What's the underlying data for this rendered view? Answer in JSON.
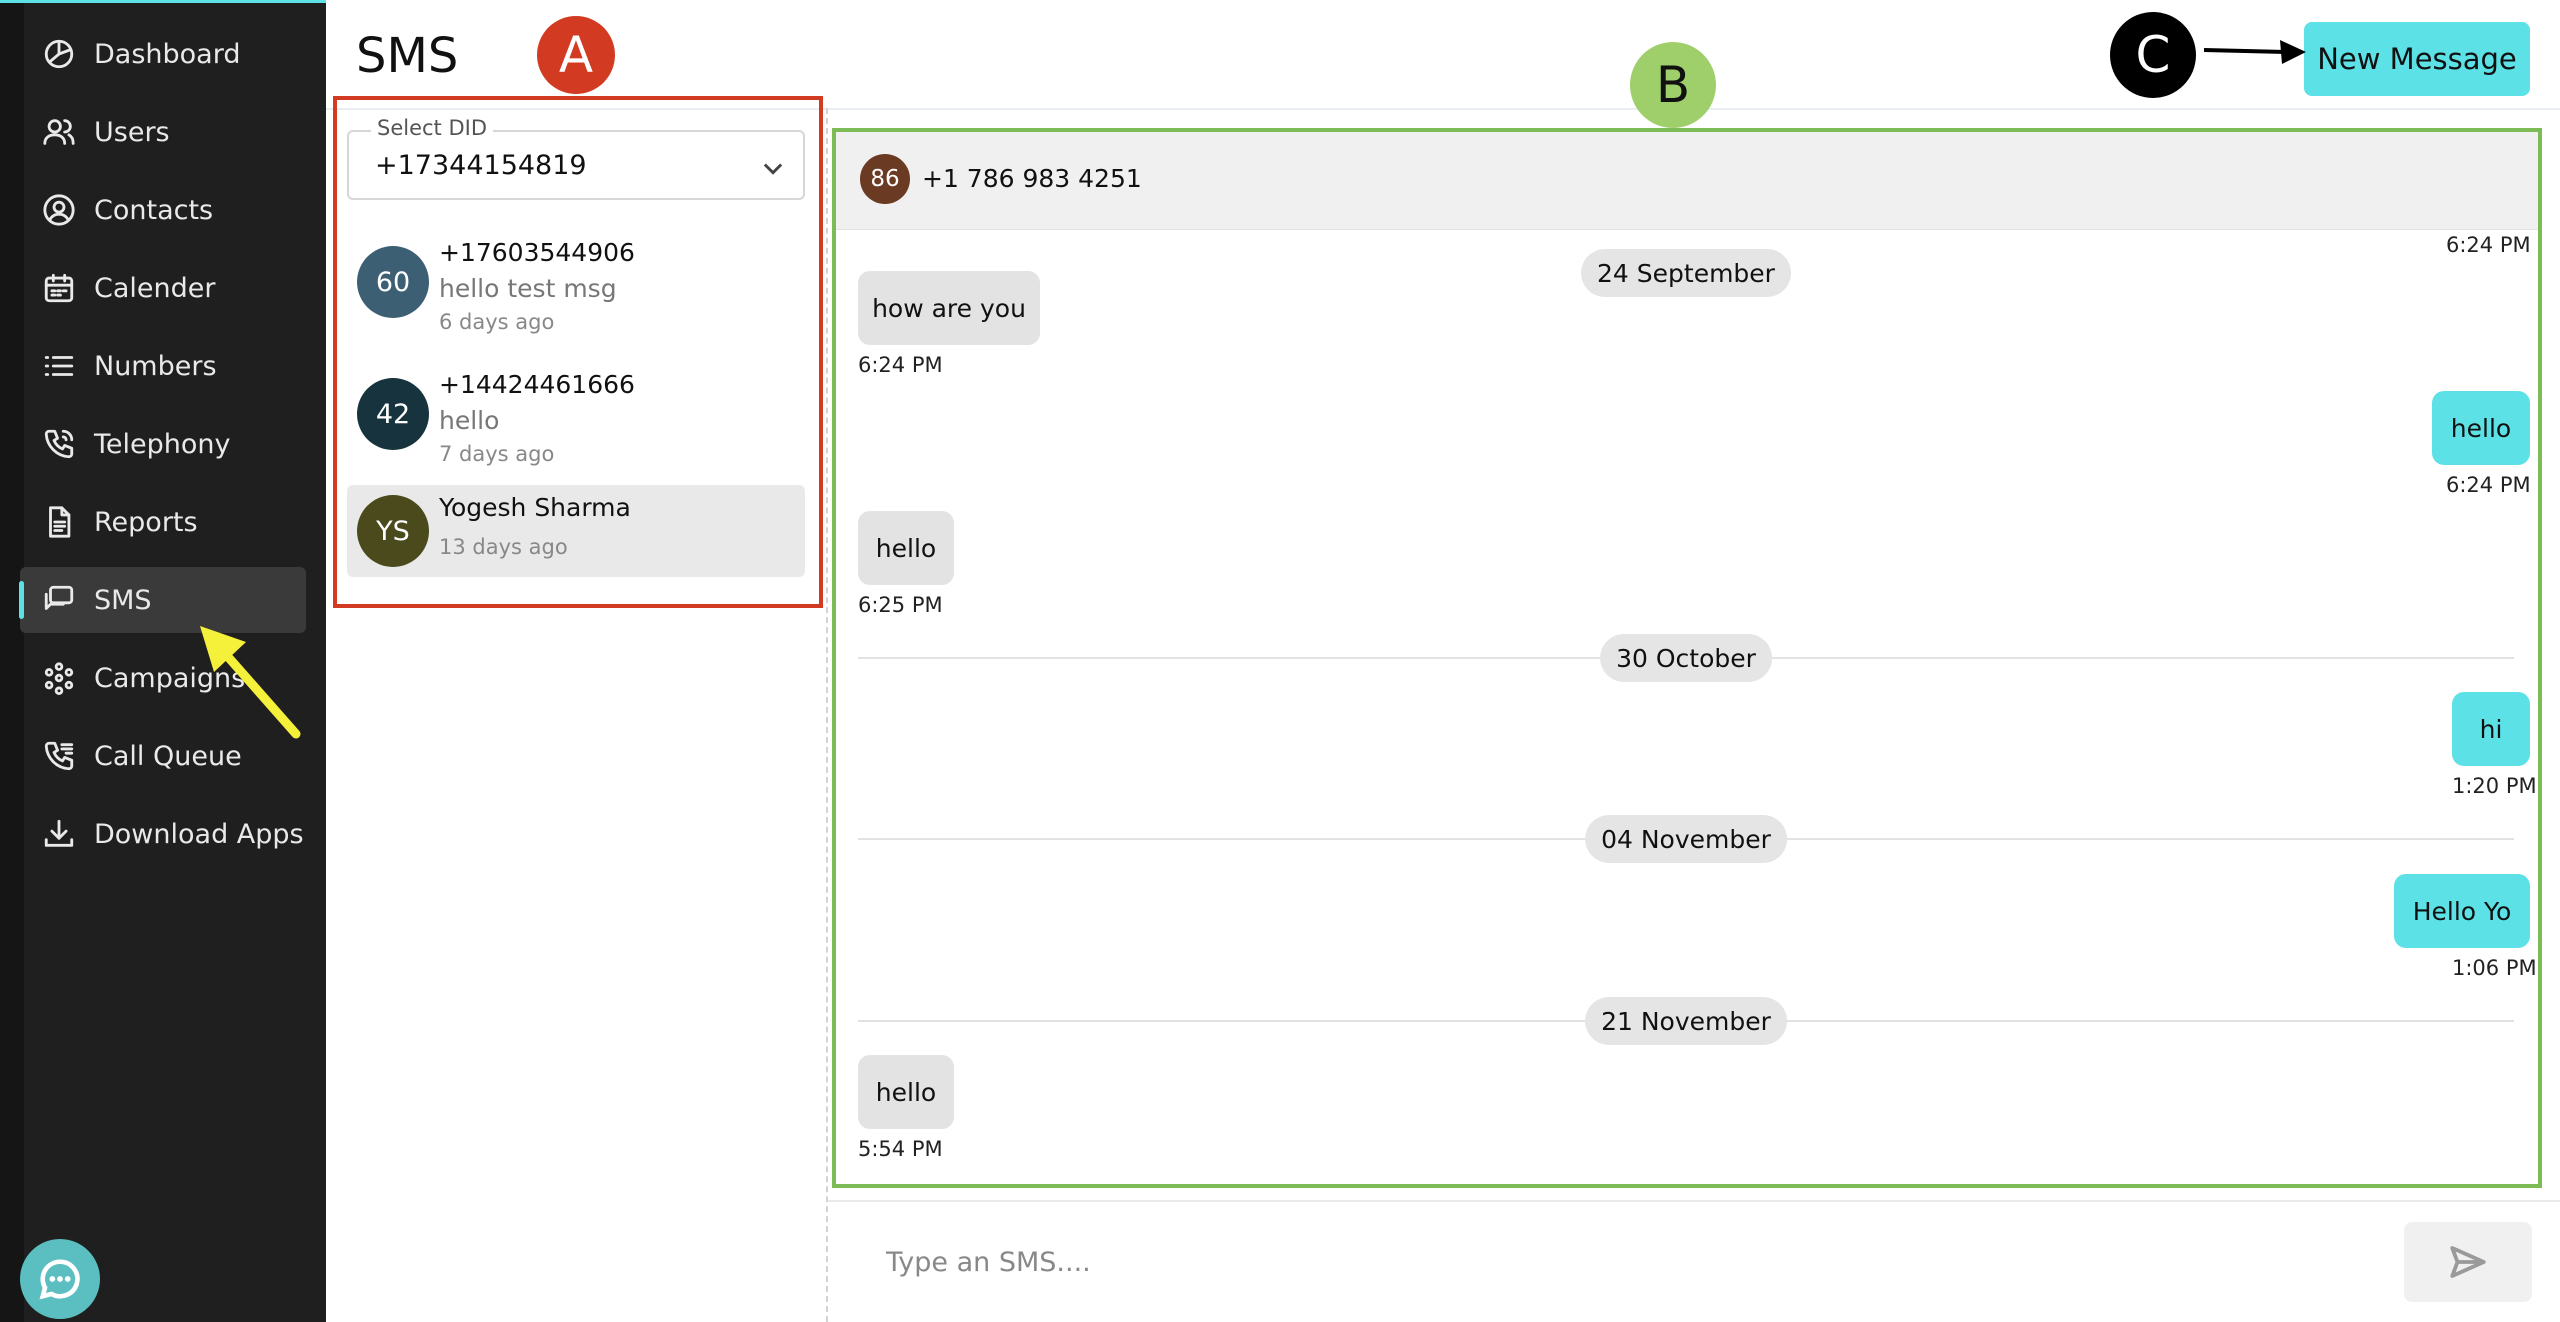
{
  "sidebar": {
    "items": [
      {
        "label": "Dashboard",
        "icon": "dashboard-icon"
      },
      {
        "label": "Users",
        "icon": "users-icon"
      },
      {
        "label": "Contacts",
        "icon": "contacts-icon"
      },
      {
        "label": "Calender",
        "icon": "calendar-icon"
      },
      {
        "label": "Numbers",
        "icon": "list-icon"
      },
      {
        "label": "Telephony",
        "icon": "phone-icon"
      },
      {
        "label": "Reports",
        "icon": "document-icon"
      },
      {
        "label": "SMS",
        "icon": "chat-icon",
        "active": true
      },
      {
        "label": "Campaigns",
        "icon": "campaigns-icon"
      },
      {
        "label": "Call Queue",
        "icon": "call-queue-icon"
      },
      {
        "label": "Download Apps",
        "icon": "download-icon"
      }
    ]
  },
  "header": {
    "title": "SMS",
    "new_message_label": "New Message"
  },
  "annotations": {
    "a": "A",
    "b": "B",
    "c": "C"
  },
  "did": {
    "label": "Select DID",
    "value": "+17344154819"
  },
  "conversations": [
    {
      "avatar": "60",
      "avatar_color": "#3d5f74",
      "name": "+17603544906",
      "preview": "hello test msg",
      "time": "6 days ago"
    },
    {
      "avatar": "42",
      "avatar_color": "#16333e",
      "name": "+14424461666",
      "preview": "hello",
      "time": "7 days ago"
    },
    {
      "avatar": "YS",
      "avatar_color": "#4a4a1c",
      "name": "Yogesh Sharma",
      "time": "13 days ago",
      "selected": true
    }
  ],
  "chat": {
    "contact_avatar": "86",
    "contact_name": "+1 786 983 4251",
    "header_time": "6:24 PM",
    "dates": [
      "24 September",
      "30 October",
      "04 November",
      "21 November"
    ],
    "messages": [
      {
        "text": "how are you",
        "time": "6:24 PM",
        "direction": "in"
      },
      {
        "text": "hello",
        "time": "6:24 PM",
        "direction": "out"
      },
      {
        "text": "hello",
        "time": "6:25 PM",
        "direction": "in"
      },
      {
        "text": "hi",
        "time": "1:20 PM",
        "direction": "out"
      },
      {
        "text": "Hello Yo",
        "time": "1:06 PM",
        "direction": "out"
      },
      {
        "text": "hello",
        "time": "5:54 PM",
        "direction": "in"
      }
    ]
  },
  "composer": {
    "placeholder": "Type an SMS...."
  },
  "colors": {
    "accent": "#5ce1e6",
    "sidebar_bg": "#1f1f1f",
    "marker_a": "#d33a22",
    "marker_b": "#9ecf6a",
    "highlight_box_b": "#7cbb55"
  }
}
